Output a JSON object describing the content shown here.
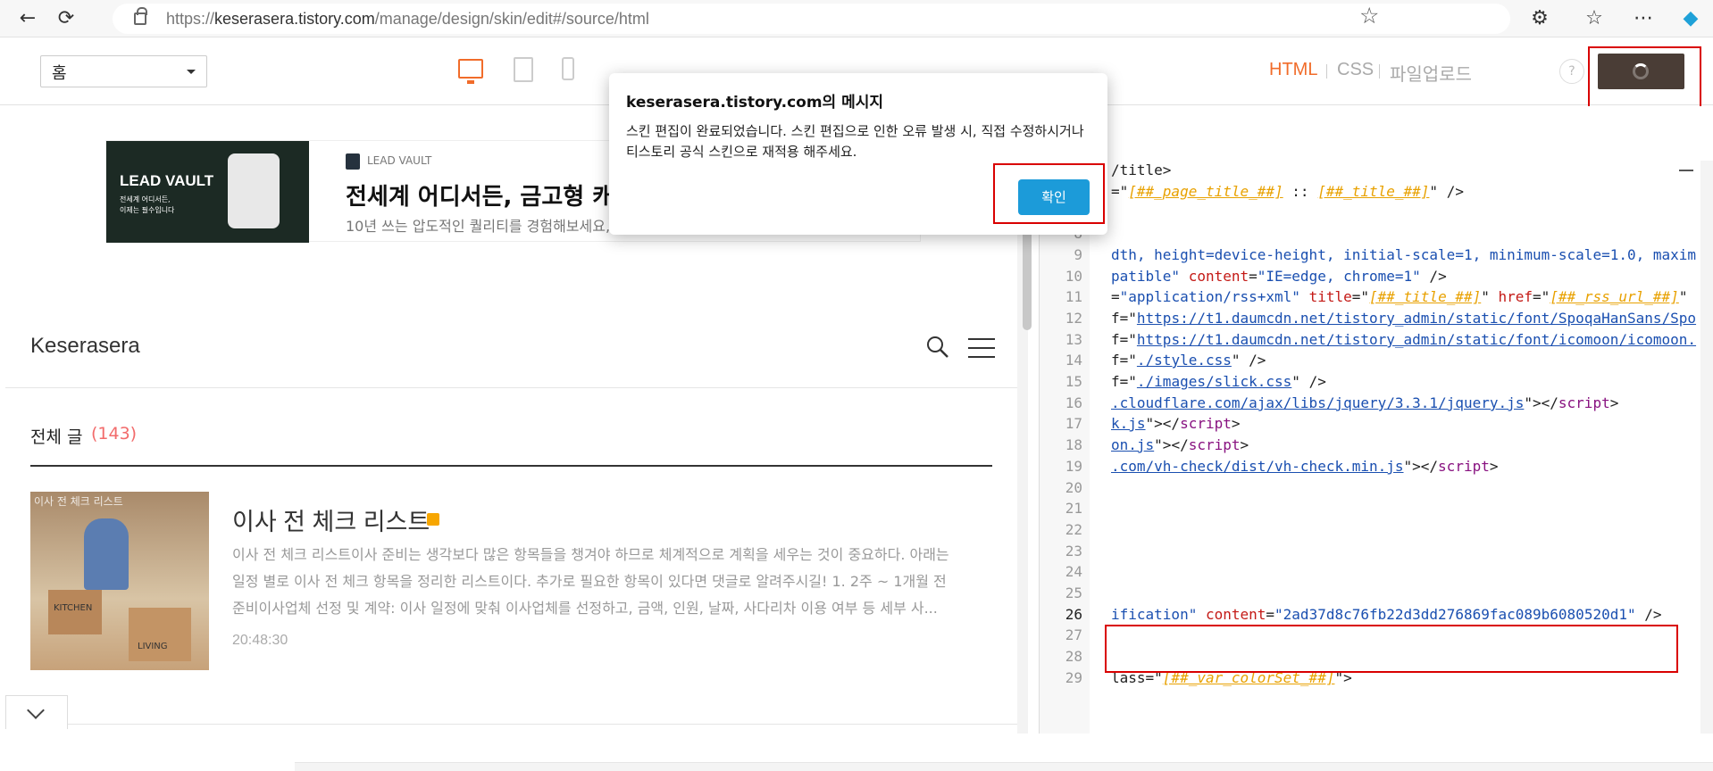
{
  "browser": {
    "url_prefix": "https://",
    "url_host": "keserasera.tistory.com",
    "url_path": "/manage/design/skin/edit#/source/html"
  },
  "toolbar": {
    "page_select_value": "홈",
    "tab_html": "HTML",
    "tab_css": "CSS",
    "tab_upload": "파일업로드",
    "help_label": "?"
  },
  "preview": {
    "ad": {
      "brand_big": "LEAD VAULT",
      "sub1": "전세계 어디서든,",
      "sub2": "이제는 필수입니다",
      "logo_text": "LEAD VAULT",
      "title": "전세계 어디서든, 금고형 캐리어 ...프로모션",
      "desc": "10년 쓰는 압도적인 퀄리티를 경험해보세요, 전사이즈 주문폭주로 품절 예상됩..."
    },
    "blog_title": "Keserasera",
    "category_label": "전체 글",
    "category_count": "(143)",
    "post": {
      "thumb_tag": "이사 전 체크 리스트",
      "box_label_1": "KITCHEN",
      "box_label_2": "LIVING",
      "title": "이사 전 체크 리스트",
      "excerpt": "이사 전 체크 리스트이사 준비는 생각보다 많은 항목들을 챙겨야 하므로 체계적으로 계획을 세우는 것이 중요하다.  아래는 일정 별로 이사 전 체크 항목을 정리한 리스트이다. 추가로 필요한 항목이 있다면 댓글로 알려주시길! 1. 2주 ~ 1개월 전 준비이사업체 선정 및 계약: 이사 일정에 맞춰 이사업체를 선정하고, 금액, 인원, 날짜, 사다리차 이용 여부 등 세부 사...",
      "time": "20:48:30"
    }
  },
  "code": {
    "lines": [
      {
        "n": "5",
        "parts": [
          {
            "c": "t-txt",
            "t": "/title>"
          }
        ]
      },
      {
        "n": "6",
        "parts": [
          {
            "c": "t-txt",
            "t": "=\""
          },
          {
            "c": "t-var",
            "t": "[##_page_title_##]"
          },
          {
            "c": "t-txt",
            "t": " :: "
          },
          {
            "c": "t-var",
            "t": "[##_title_##]"
          },
          {
            "c": "t-txt",
            "t": "\" />"
          }
        ]
      },
      {
        "n": "7",
        "parts": []
      },
      {
        "n": "8",
        "parts": []
      },
      {
        "n": "9",
        "parts": [
          {
            "c": "t-str",
            "t": "dth, height=device-height, initial-scale=1, minimum-scale=1.0, maxim"
          }
        ]
      },
      {
        "n": "10",
        "parts": [
          {
            "c": "t-str",
            "t": "patible\""
          },
          {
            "c": "t-attr",
            "t": " content"
          },
          {
            "c": "t-txt",
            "t": "="
          },
          {
            "c": "t-str",
            "t": "\"IE=edge, chrome=1\""
          },
          {
            "c": "t-txt",
            "t": " />"
          }
        ]
      },
      {
        "n": "11",
        "parts": [
          {
            "c": "t-txt",
            "t": "="
          },
          {
            "c": "t-str",
            "t": "\"application/rss+xml\""
          },
          {
            "c": "t-attr",
            "t": " title"
          },
          {
            "c": "t-txt",
            "t": "=\""
          },
          {
            "c": "t-var",
            "t": "[##_title_##]"
          },
          {
            "c": "t-txt",
            "t": "\""
          },
          {
            "c": "t-attr",
            "t": " href"
          },
          {
            "c": "t-txt",
            "t": "=\""
          },
          {
            "c": "t-var",
            "t": "[##_rss_url_##]"
          },
          {
            "c": "t-txt",
            "t": "\""
          }
        ]
      },
      {
        "n": "12",
        "parts": [
          {
            "c": "t-txt",
            "t": "f=\""
          },
          {
            "c": "t-link",
            "t": "https://t1.daumcdn.net/tistory_admin/static/font/SpoqaHanSans/Spo"
          }
        ]
      },
      {
        "n": "13",
        "parts": [
          {
            "c": "t-txt",
            "t": "f=\""
          },
          {
            "c": "t-link",
            "t": "https://t1.daumcdn.net/tistory_admin/static/font/icomoon/icomoon."
          }
        ]
      },
      {
        "n": "14",
        "parts": [
          {
            "c": "t-txt",
            "t": "f=\""
          },
          {
            "c": "t-link",
            "t": "./style.css"
          },
          {
            "c": "t-txt",
            "t": "\" />"
          }
        ]
      },
      {
        "n": "15",
        "parts": [
          {
            "c": "t-txt",
            "t": "f=\""
          },
          {
            "c": "t-link",
            "t": "./images/slick.css"
          },
          {
            "c": "t-txt",
            "t": "\" />"
          }
        ]
      },
      {
        "n": "16",
        "parts": [
          {
            "c": "t-link",
            "t": ".cloudflare.com/ajax/libs/jquery/3.3.1/jquery.js"
          },
          {
            "c": "t-txt",
            "t": "\"></"
          },
          {
            "c": "t-tag",
            "t": "script"
          },
          {
            "c": "t-txt",
            "t": ">"
          }
        ]
      },
      {
        "n": "17",
        "parts": [
          {
            "c": "t-link",
            "t": "k.js"
          },
          {
            "c": "t-txt",
            "t": "\"></"
          },
          {
            "c": "t-tag",
            "t": "script"
          },
          {
            "c": "t-txt",
            "t": ">"
          }
        ]
      },
      {
        "n": "18",
        "parts": [
          {
            "c": "t-link",
            "t": "on.js"
          },
          {
            "c": "t-txt",
            "t": "\"></"
          },
          {
            "c": "t-tag",
            "t": "script"
          },
          {
            "c": "t-txt",
            "t": ">"
          }
        ]
      },
      {
        "n": "19",
        "parts": [
          {
            "c": "t-link",
            "t": ".com/vh-check/dist/vh-check.min.js"
          },
          {
            "c": "t-txt",
            "t": "\"></"
          },
          {
            "c": "t-tag",
            "t": "script"
          },
          {
            "c": "t-txt",
            "t": ">"
          }
        ]
      },
      {
        "n": "20",
        "parts": []
      },
      {
        "n": "21",
        "parts": []
      },
      {
        "n": "22",
        "parts": []
      },
      {
        "n": "23",
        "parts": []
      },
      {
        "n": "24",
        "parts": []
      },
      {
        "n": "25",
        "parts": []
      },
      {
        "n": "26",
        "hl": true,
        "parts": [
          {
            "c": "t-str",
            "t": "ification\""
          },
          {
            "c": "t-attr",
            "t": " content"
          },
          {
            "c": "t-txt",
            "t": "="
          },
          {
            "c": "t-str",
            "t": "\"2ad37d8c76fb22d3dd276869fac089b6080520d1\""
          },
          {
            "c": "t-txt",
            "t": " />"
          }
        ]
      },
      {
        "n": "27",
        "parts": []
      },
      {
        "n": "28",
        "parts": []
      },
      {
        "n": "29",
        "parts": [
          {
            "c": "t-txt",
            "t": "lass=\""
          },
          {
            "c": "t-var",
            "t": "[##_var_colorSet_##]"
          },
          {
            "c": "t-txt",
            "t": "\">"
          }
        ]
      }
    ]
  },
  "dialog": {
    "title": "keserasera.tistory.com의 메시지",
    "message": "스킨 편집이 완료되었습니다. 스킨 편집으로 인한 오류 발생 시, 직접 수정하시거나 티스토리 공식 스킨으로 재적용 해주세요.",
    "ok_label": "확인"
  },
  "colors": {
    "accent": "#f16c2a",
    "save_button": "#4a3d36",
    "ok_button": "#1c9bd9",
    "highlight_frame": "#d90000",
    "count": "#f26b6b"
  },
  "icons": [
    "back-icon",
    "refresh-icon",
    "lock-icon",
    "star-icon",
    "extensions-icon",
    "favorites-icon",
    "more-icon",
    "copilot-icon",
    "desktop-icon",
    "tablet-icon",
    "mobile-icon",
    "search-icon",
    "menu-icon",
    "chevron-down-icon"
  ]
}
